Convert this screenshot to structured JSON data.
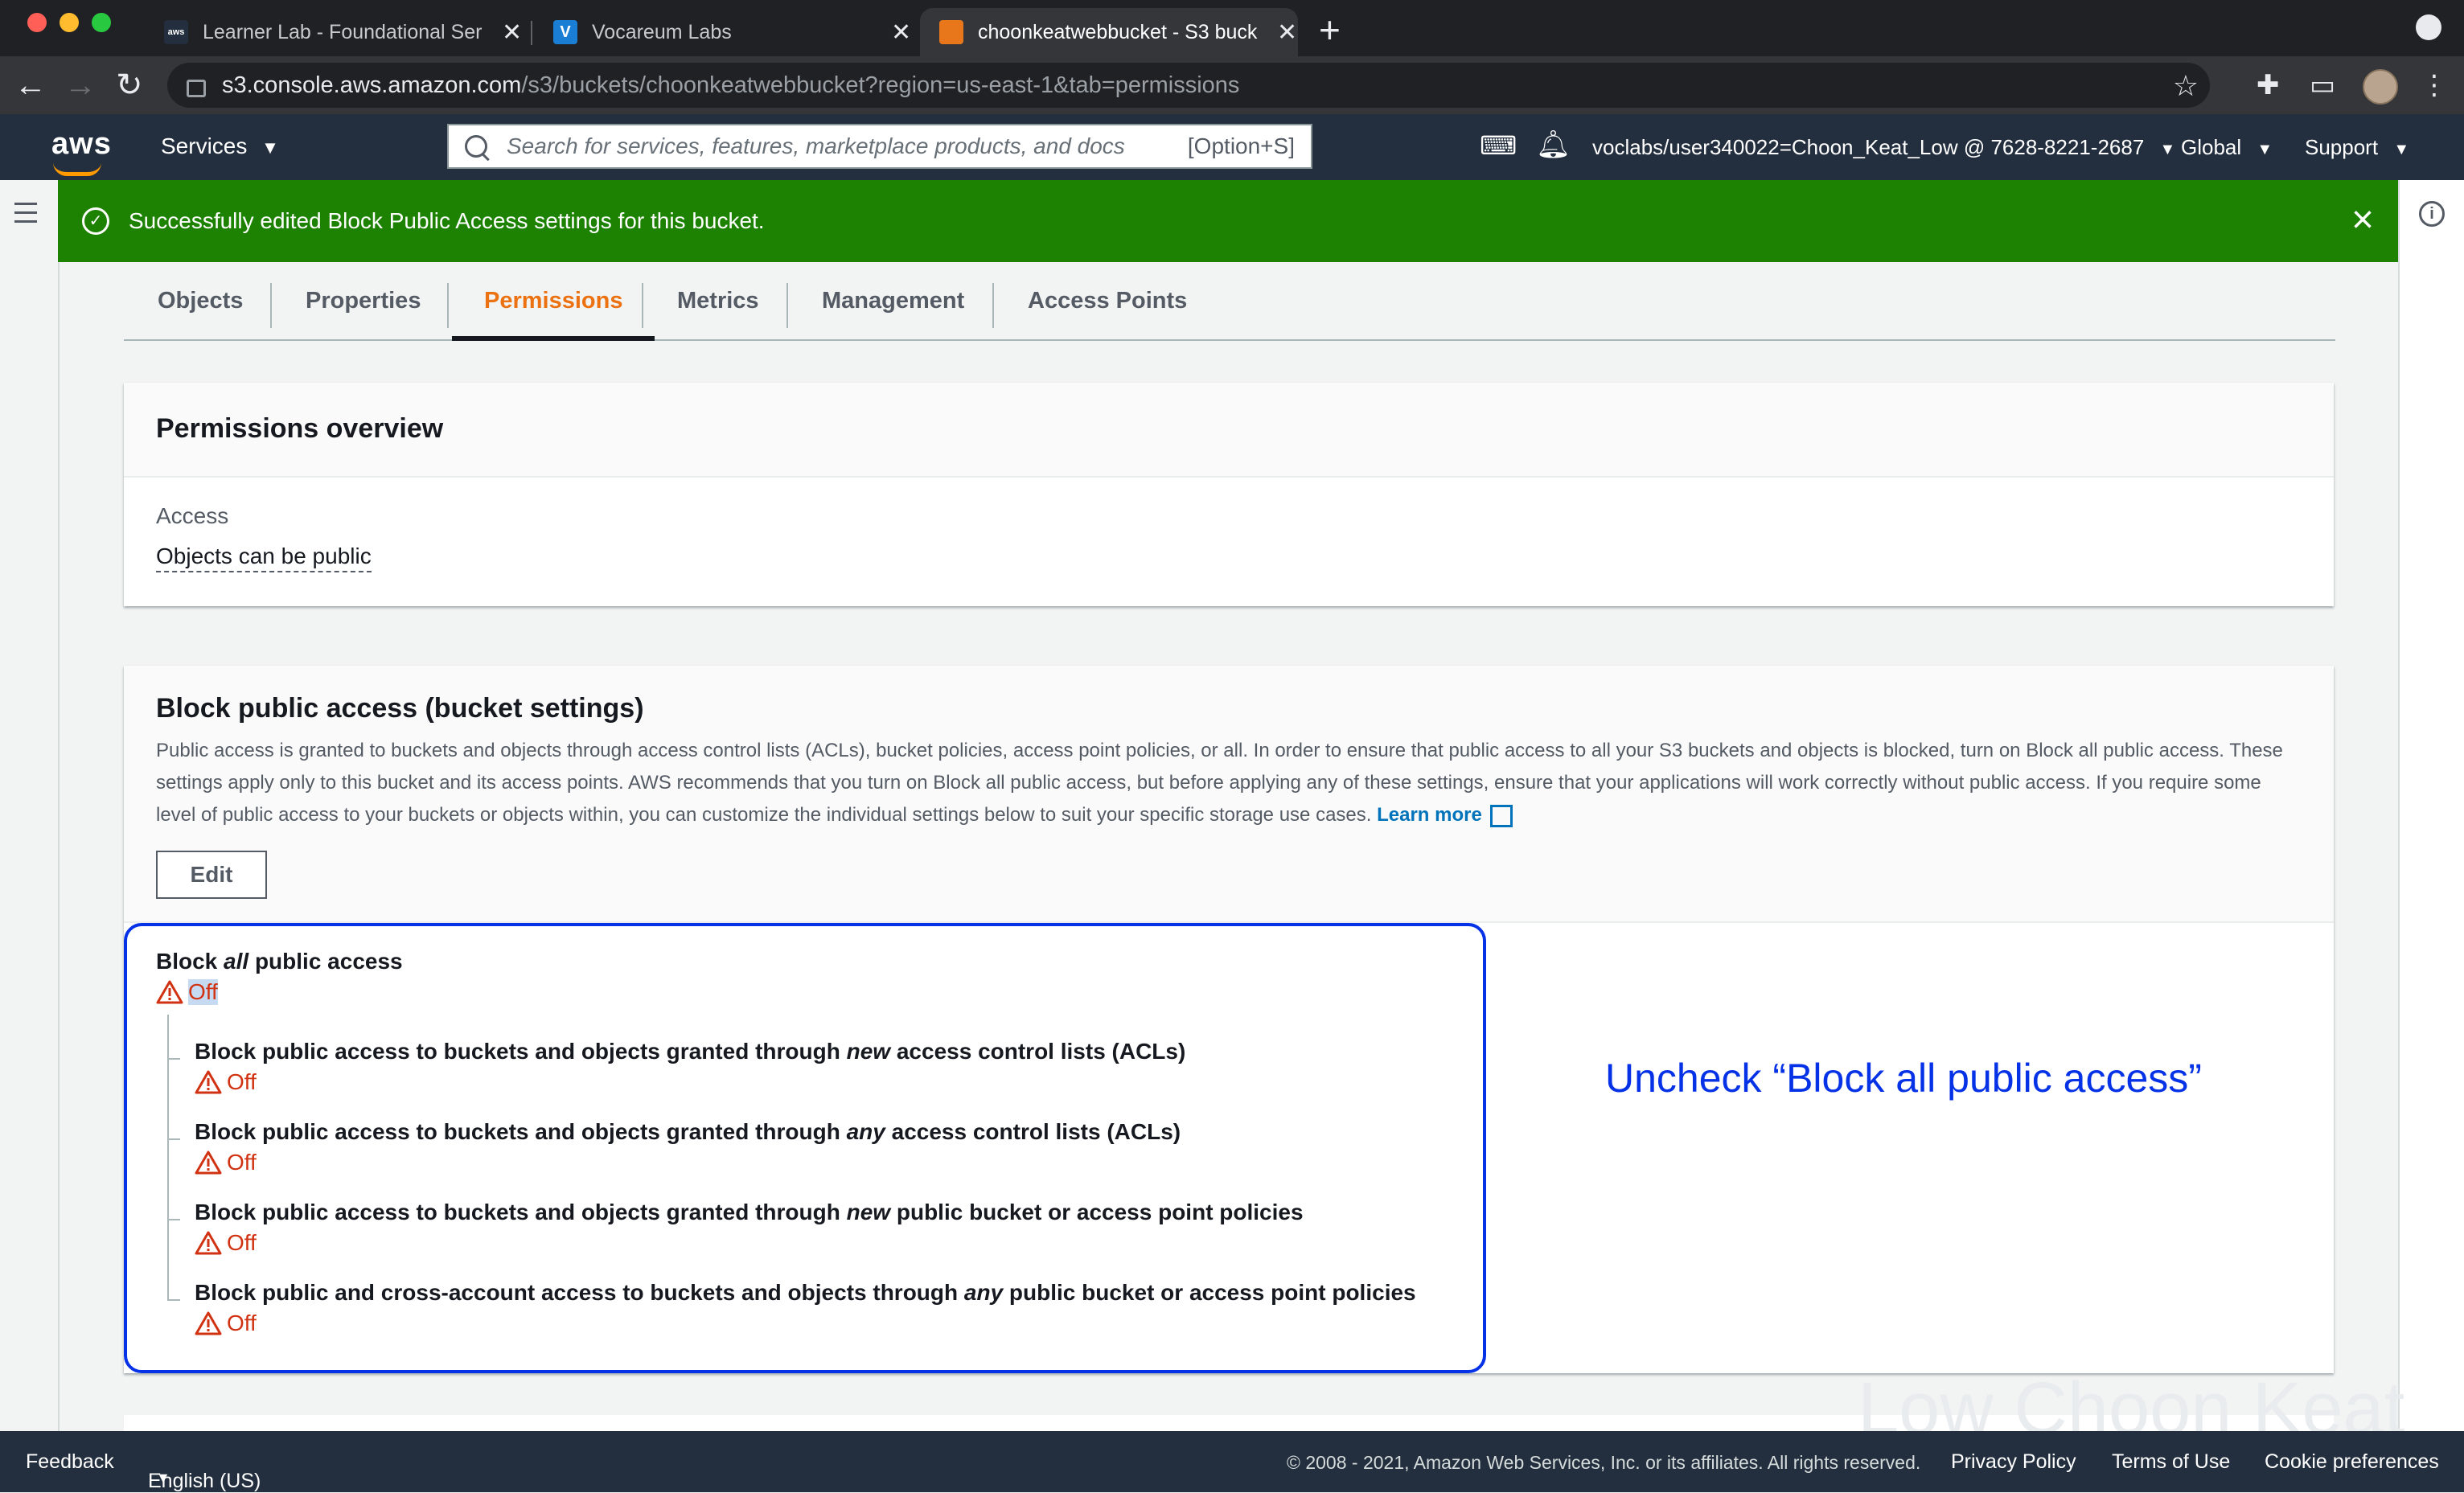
{
  "browser": {
    "tabs": [
      {
        "title": "Learner Lab - Foundational Ser",
        "favicon": "aws-favicon",
        "active": false
      },
      {
        "title": "Vocareum Labs",
        "favicon": "vocareum-favicon",
        "active": false
      },
      {
        "title": "choonkeatwebbucket - S3 buck",
        "favicon": "s3-favicon",
        "active": true
      }
    ],
    "url_host": "s3.console.aws.amazon.com",
    "url_path": "/s3/buckets/choonkeatwebbucket?region=us-east-1&tab=permissions"
  },
  "aws_header": {
    "logo": "aws",
    "services_label": "Services",
    "search_placeholder": "Search for services, features, marketplace products, and docs",
    "search_shortcut": "[Option+S]",
    "account": "voclabs/user340022=Choon_Keat_Low @ 7628-8221-2687",
    "region": "Global",
    "support": "Support"
  },
  "flash": {
    "message": "Successfully edited Block Public Access settings for this bucket.",
    "color": "#1d8102"
  },
  "tabs": [
    {
      "label": "Objects"
    },
    {
      "label": "Properties"
    },
    {
      "label": "Permissions",
      "active": true
    },
    {
      "label": "Metrics"
    },
    {
      "label": "Management"
    },
    {
      "label": "Access Points"
    }
  ],
  "permissions_overview": {
    "title": "Permissions overview",
    "access_label": "Access",
    "access_value": "Objects can be public"
  },
  "block_public_access": {
    "title": "Block public access (bucket settings)",
    "description": "Public access is granted to buckets and objects through access control lists (ACLs), bucket policies, access point policies, or all. In order to ensure that public access to all your S3 buckets and objects is blocked, turn on Block all public access. These settings apply only to this bucket and its access points. AWS recommends that you turn on Block all public access, but before applying any of these settings, ensure that your applications will work correctly without public access. If you require some level of public access to your buckets or objects within, you can customize the individual settings below to suit your specific storage use cases.",
    "learn_more": "Learn more",
    "edit_label": "Edit",
    "main_setting": {
      "pre": "Block ",
      "em": "all",
      "post": " public access",
      "status": "Off"
    },
    "settings": [
      {
        "pre": "Block public access to buckets and objects granted through ",
        "em": "new",
        "post": " access control lists (ACLs)",
        "status": "Off"
      },
      {
        "pre": "Block public access to buckets and objects granted through ",
        "em": "any",
        "post": " access control lists (ACLs)",
        "status": "Off"
      },
      {
        "pre": "Block public access to buckets and objects granted through ",
        "em": "new",
        "post": " public bucket or access point policies",
        "status": "Off"
      },
      {
        "pre": "Block public and cross-account access to buckets and objects through ",
        "em": "any",
        "post": " public bucket or access point policies",
        "status": "Off"
      }
    ],
    "warning_color": "#d13212"
  },
  "annotation": {
    "text": "Uncheck “Block all public access”",
    "color": "#0532e6"
  },
  "watermark": "Low Choon Keat",
  "footer": {
    "feedback": "Feedback",
    "language": "English (US)",
    "copyright": "© 2008 - 2021, Amazon Web Services, Inc. or its affiliates. All rights reserved.",
    "privacy": "Privacy Policy",
    "terms": "Terms of Use",
    "cookies": "Cookie preferences"
  }
}
